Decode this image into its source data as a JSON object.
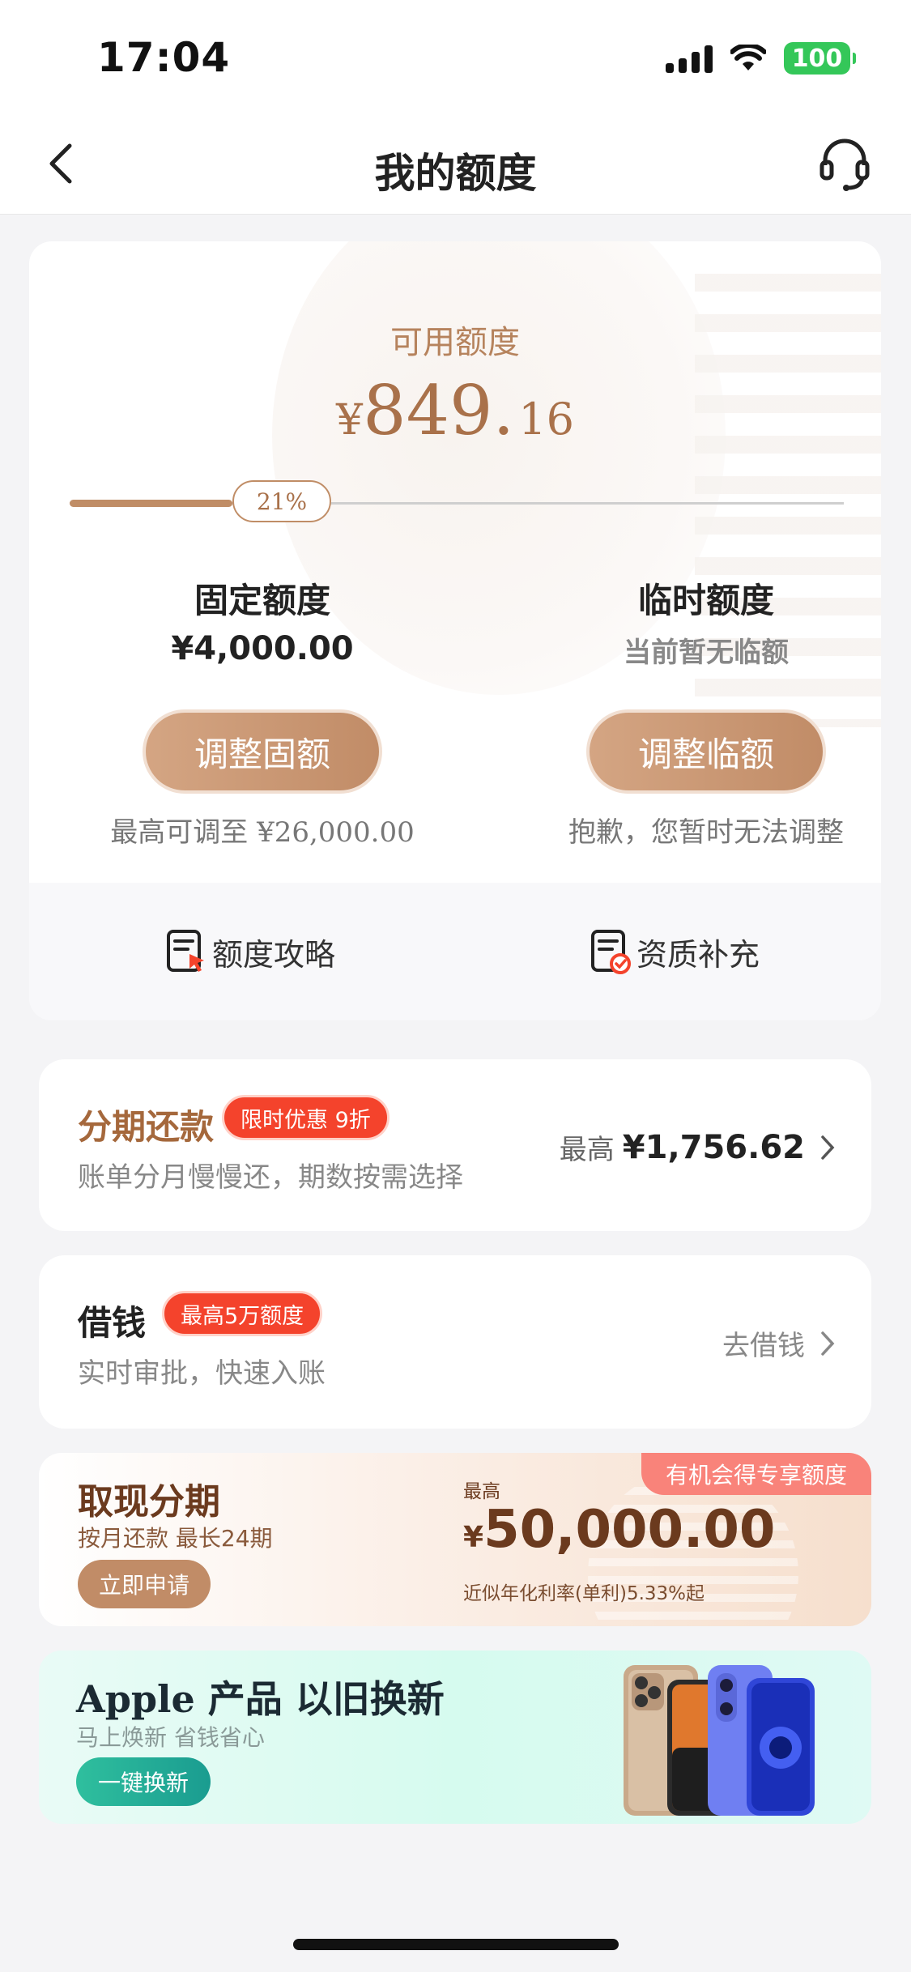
{
  "status_bar": {
    "time": "17:04",
    "battery": "100"
  },
  "nav": {
    "title": "我的额度"
  },
  "credit": {
    "available_label": "可用额度",
    "currency": "¥",
    "available_integer": "849.",
    "available_decimal": "16",
    "usage_percent_label": "21%",
    "usage_fraction": 0.21,
    "fixed": {
      "title": "固定额度",
      "value": "¥4,000.00",
      "button": "调整固额",
      "note_prefix": "最高可调至 ",
      "note_value": "¥26,000.00"
    },
    "temporary": {
      "title": "临时额度",
      "value": "当前暂无临额",
      "button": "调整临额",
      "note": "抱歉，您暂时无法调整"
    },
    "links": [
      {
        "label": "额度攻略",
        "icon": "document-pointer-icon"
      },
      {
        "label": "资质补充",
        "icon": "document-check-icon"
      }
    ]
  },
  "installment": {
    "title": "分期还款",
    "tag": "限时优惠 9折",
    "subtitle": "账单分月慢慢还，期数按需选择",
    "max_label": "最高",
    "max_amount": "¥1,756.62"
  },
  "borrow": {
    "title": "借钱",
    "tag": "最高5万额度",
    "subtitle": "实时审批，快速入账",
    "action": "去借钱"
  },
  "cash_banner": {
    "title": "取现分期",
    "subtitle": "按月还款 最长24期",
    "button": "立即申请",
    "max_label": "最高",
    "currency": "¥",
    "amount": "50,000.00",
    "rate": "近似年化利率(单利)5.33%起",
    "corner_tag": "有机会得专享额度"
  },
  "apple_banner": {
    "title": "Apple 产品 以旧换新",
    "subtitle": "马上焕新 省钱省心",
    "button": "一键换新"
  },
  "colors": {
    "accent_brown": "#c18c67",
    "tag_red": "#f4432c",
    "battery_green": "#34c759",
    "teal": "#1a9c90"
  }
}
